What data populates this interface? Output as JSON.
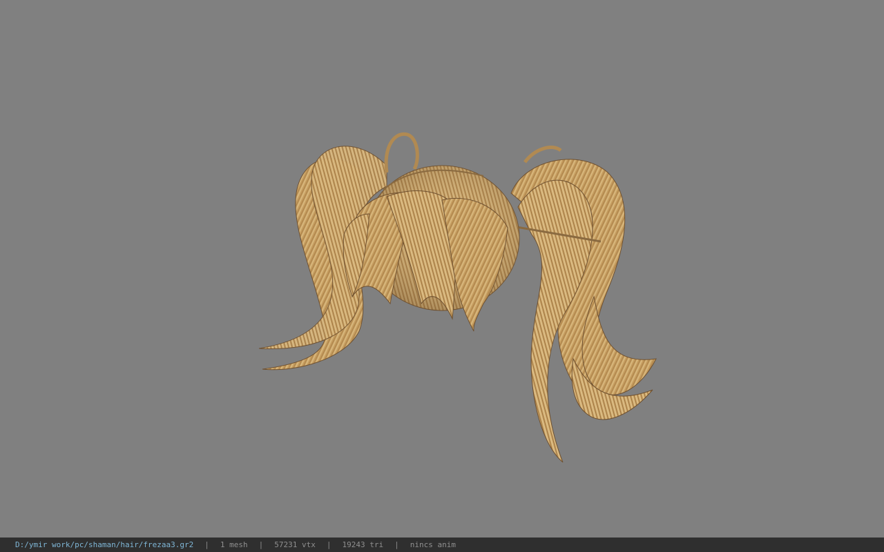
{
  "viewer": {
    "background_color": "#808080",
    "model_name": "hair-model-twin-tails",
    "model_color": "#c9a266"
  },
  "status_bar": {
    "file_path": "D:/ymir work/pc/shaman/hair/frezaa3.gr2",
    "separator": "|",
    "mesh_count": "1 mesh",
    "vertex_count": "57231 vtx",
    "triangle_count": "19243 tri",
    "animation": "nincs anim"
  }
}
